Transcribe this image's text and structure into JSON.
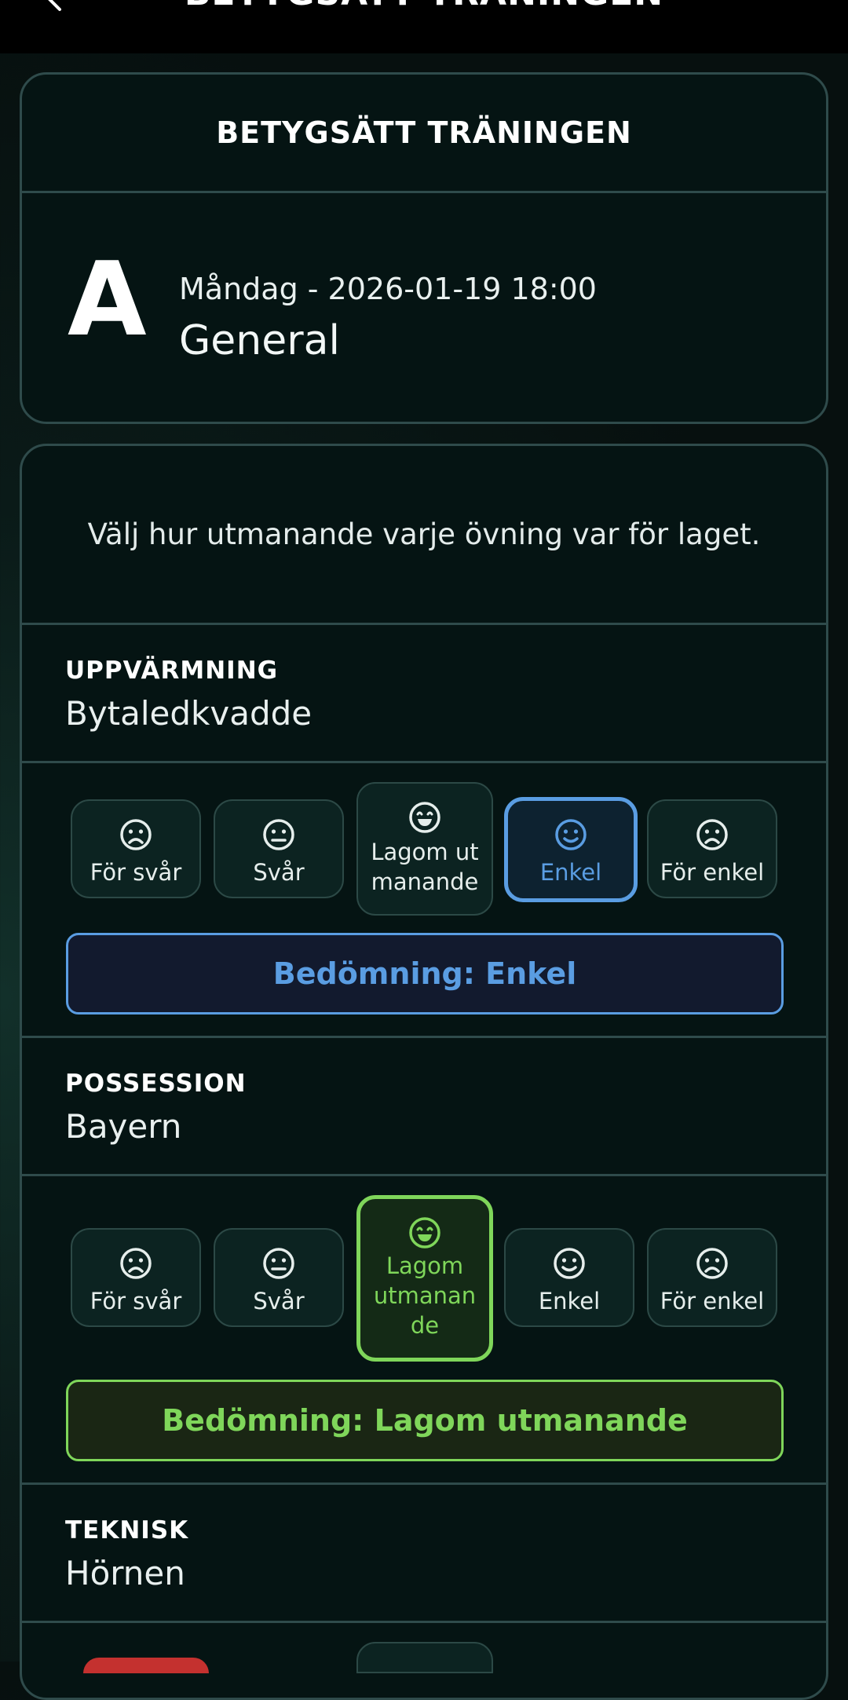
{
  "topbar": {
    "title": "BETYGSÄTT TRÄNINGEN"
  },
  "summary": {
    "header": "BETYGSÄTT TRÄNINGEN",
    "team_letter": "A",
    "date": "Måndag - 2026-01-19 18:00",
    "session_name": "General"
  },
  "intro_text": "Välj hur utmanande varje övning var för laget.",
  "options": [
    "För svår",
    "Svår",
    "Lagom ut manande",
    "Enkel",
    "För enkel"
  ],
  "exercises": [
    {
      "category": "UPPVÄRMNING",
      "name": "Bytaledkvadde",
      "options": [
        "För svår",
        "Svår",
        "Lagom ut\nmanande",
        "Enkel",
        "För enkel"
      ],
      "selected": "Enkel",
      "verdict": "Bedömning: Enkel",
      "accent": "#5a9de2"
    },
    {
      "category": "POSSESSION",
      "name": "Bayern",
      "options": [
        "För svår",
        "Svår",
        "Lagom\nutmanan\nde",
        "Enkel",
        "För enkel"
      ],
      "selected": "Lagom utmanande",
      "verdict": "Bedömning: Lagom utmanande",
      "accent": "#7fd65a"
    },
    {
      "category": "TEKNISK",
      "name": "Hörnen"
    }
  ],
  "icons": {
    "back": "chevron-left-icon",
    "too_hard": "frown-icon",
    "hard": "neutral-face-icon",
    "just_right": "grin-icon",
    "easy": "smile-icon",
    "too_easy": "frown-icon"
  },
  "colors": {
    "blue": "#5a9de2",
    "green": "#7fd65a",
    "border": "#2f4b4b",
    "red": "#c4312f"
  }
}
